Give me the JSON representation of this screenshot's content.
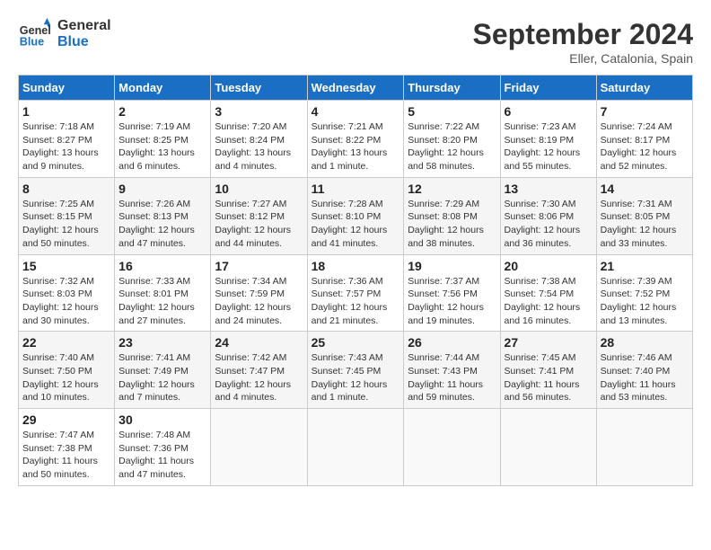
{
  "header": {
    "logo_line1": "General",
    "logo_line2": "Blue",
    "month_title": "September 2024",
    "location": "Eller, Catalonia, Spain"
  },
  "weekdays": [
    "Sunday",
    "Monday",
    "Tuesday",
    "Wednesday",
    "Thursday",
    "Friday",
    "Saturday"
  ],
  "weeks": [
    [
      {
        "day": "1",
        "info": "Sunrise: 7:18 AM\nSunset: 8:27 PM\nDaylight: 13 hours\nand 9 minutes."
      },
      {
        "day": "2",
        "info": "Sunrise: 7:19 AM\nSunset: 8:25 PM\nDaylight: 13 hours\nand 6 minutes."
      },
      {
        "day": "3",
        "info": "Sunrise: 7:20 AM\nSunset: 8:24 PM\nDaylight: 13 hours\nand 4 minutes."
      },
      {
        "day": "4",
        "info": "Sunrise: 7:21 AM\nSunset: 8:22 PM\nDaylight: 13 hours\nand 1 minute."
      },
      {
        "day": "5",
        "info": "Sunrise: 7:22 AM\nSunset: 8:20 PM\nDaylight: 12 hours\nand 58 minutes."
      },
      {
        "day": "6",
        "info": "Sunrise: 7:23 AM\nSunset: 8:19 PM\nDaylight: 12 hours\nand 55 minutes."
      },
      {
        "day": "7",
        "info": "Sunrise: 7:24 AM\nSunset: 8:17 PM\nDaylight: 12 hours\nand 52 minutes."
      }
    ],
    [
      {
        "day": "8",
        "info": "Sunrise: 7:25 AM\nSunset: 8:15 PM\nDaylight: 12 hours\nand 50 minutes."
      },
      {
        "day": "9",
        "info": "Sunrise: 7:26 AM\nSunset: 8:13 PM\nDaylight: 12 hours\nand 47 minutes."
      },
      {
        "day": "10",
        "info": "Sunrise: 7:27 AM\nSunset: 8:12 PM\nDaylight: 12 hours\nand 44 minutes."
      },
      {
        "day": "11",
        "info": "Sunrise: 7:28 AM\nSunset: 8:10 PM\nDaylight: 12 hours\nand 41 minutes."
      },
      {
        "day": "12",
        "info": "Sunrise: 7:29 AM\nSunset: 8:08 PM\nDaylight: 12 hours\nand 38 minutes."
      },
      {
        "day": "13",
        "info": "Sunrise: 7:30 AM\nSunset: 8:06 PM\nDaylight: 12 hours\nand 36 minutes."
      },
      {
        "day": "14",
        "info": "Sunrise: 7:31 AM\nSunset: 8:05 PM\nDaylight: 12 hours\nand 33 minutes."
      }
    ],
    [
      {
        "day": "15",
        "info": "Sunrise: 7:32 AM\nSunset: 8:03 PM\nDaylight: 12 hours\nand 30 minutes."
      },
      {
        "day": "16",
        "info": "Sunrise: 7:33 AM\nSunset: 8:01 PM\nDaylight: 12 hours\nand 27 minutes."
      },
      {
        "day": "17",
        "info": "Sunrise: 7:34 AM\nSunset: 7:59 PM\nDaylight: 12 hours\nand 24 minutes."
      },
      {
        "day": "18",
        "info": "Sunrise: 7:36 AM\nSunset: 7:57 PM\nDaylight: 12 hours\nand 21 minutes."
      },
      {
        "day": "19",
        "info": "Sunrise: 7:37 AM\nSunset: 7:56 PM\nDaylight: 12 hours\nand 19 minutes."
      },
      {
        "day": "20",
        "info": "Sunrise: 7:38 AM\nSunset: 7:54 PM\nDaylight: 12 hours\nand 16 minutes."
      },
      {
        "day": "21",
        "info": "Sunrise: 7:39 AM\nSunset: 7:52 PM\nDaylight: 12 hours\nand 13 minutes."
      }
    ],
    [
      {
        "day": "22",
        "info": "Sunrise: 7:40 AM\nSunset: 7:50 PM\nDaylight: 12 hours\nand 10 minutes."
      },
      {
        "day": "23",
        "info": "Sunrise: 7:41 AM\nSunset: 7:49 PM\nDaylight: 12 hours\nand 7 minutes."
      },
      {
        "day": "24",
        "info": "Sunrise: 7:42 AM\nSunset: 7:47 PM\nDaylight: 12 hours\nand 4 minutes."
      },
      {
        "day": "25",
        "info": "Sunrise: 7:43 AM\nSunset: 7:45 PM\nDaylight: 12 hours\nand 1 minute."
      },
      {
        "day": "26",
        "info": "Sunrise: 7:44 AM\nSunset: 7:43 PM\nDaylight: 11 hours\nand 59 minutes."
      },
      {
        "day": "27",
        "info": "Sunrise: 7:45 AM\nSunset: 7:41 PM\nDaylight: 11 hours\nand 56 minutes."
      },
      {
        "day": "28",
        "info": "Sunrise: 7:46 AM\nSunset: 7:40 PM\nDaylight: 11 hours\nand 53 minutes."
      }
    ],
    [
      {
        "day": "29",
        "info": "Sunrise: 7:47 AM\nSunset: 7:38 PM\nDaylight: 11 hours\nand 50 minutes."
      },
      {
        "day": "30",
        "info": "Sunrise: 7:48 AM\nSunset: 7:36 PM\nDaylight: 11 hours\nand 47 minutes."
      },
      null,
      null,
      null,
      null,
      null
    ]
  ]
}
